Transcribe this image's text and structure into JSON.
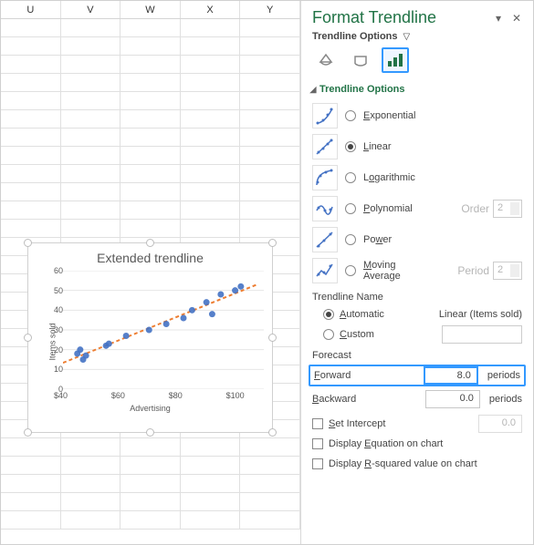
{
  "columns": [
    "U",
    "V",
    "W",
    "X",
    "Y"
  ],
  "pane": {
    "title": "Format Trendline",
    "sub": "Trendline Options",
    "section": "Trendline Options",
    "options": {
      "exponential": "Exponential",
      "linear": "Linear",
      "logarithmic": "Logarithmic",
      "polynomial": "Polynomial",
      "order_label": "Order",
      "order_value": "2",
      "power": "Power",
      "moving_avg_a": "Moving",
      "moving_avg_b": "Average",
      "period_label": "Period",
      "period_value": "2"
    },
    "name": {
      "label": "Trendline Name",
      "automatic": "Automatic",
      "auto_value": "Linear (Items sold)",
      "custom": "Custom",
      "custom_value": ""
    },
    "forecast": {
      "label": "Forecast",
      "forward_label": "Forward",
      "forward_value": "8.0",
      "backward_label": "Backward",
      "backward_value": "0.0",
      "unit": "periods"
    },
    "checks": {
      "set_intercept": "Set Intercept",
      "set_intercept_value": "0.0",
      "eq": "Display Equation on chart",
      "r2": "Display R-squared value on chart"
    }
  },
  "chart": {
    "title": "Extended trendline",
    "ylabel": "Items sold",
    "xlabel": "Advertising",
    "xticks": [
      "$40",
      "$60",
      "$80",
      "$100"
    ],
    "yticks": [
      "0",
      "10",
      "20",
      "30",
      "40",
      "50",
      "60"
    ]
  },
  "chart_data": {
    "type": "scatter",
    "title": "Extended trendline",
    "xlabel": "Advertising",
    "ylabel": "Items sold",
    "xlim": [
      40,
      110
    ],
    "ylim": [
      0,
      60
    ],
    "series": [
      {
        "name": "Items sold",
        "x": [
          45,
          46,
          47,
          48,
          55,
          56,
          62,
          70,
          76,
          82,
          85,
          90,
          92,
          95,
          100,
          102
        ],
        "y": [
          18,
          20,
          15,
          17,
          22,
          23,
          27,
          30,
          33,
          36,
          40,
          44,
          38,
          48,
          50,
          52
        ]
      }
    ],
    "trendline": {
      "type": "linear",
      "x_range": [
        40,
        108
      ],
      "forecast_forward": 8.0
    }
  }
}
